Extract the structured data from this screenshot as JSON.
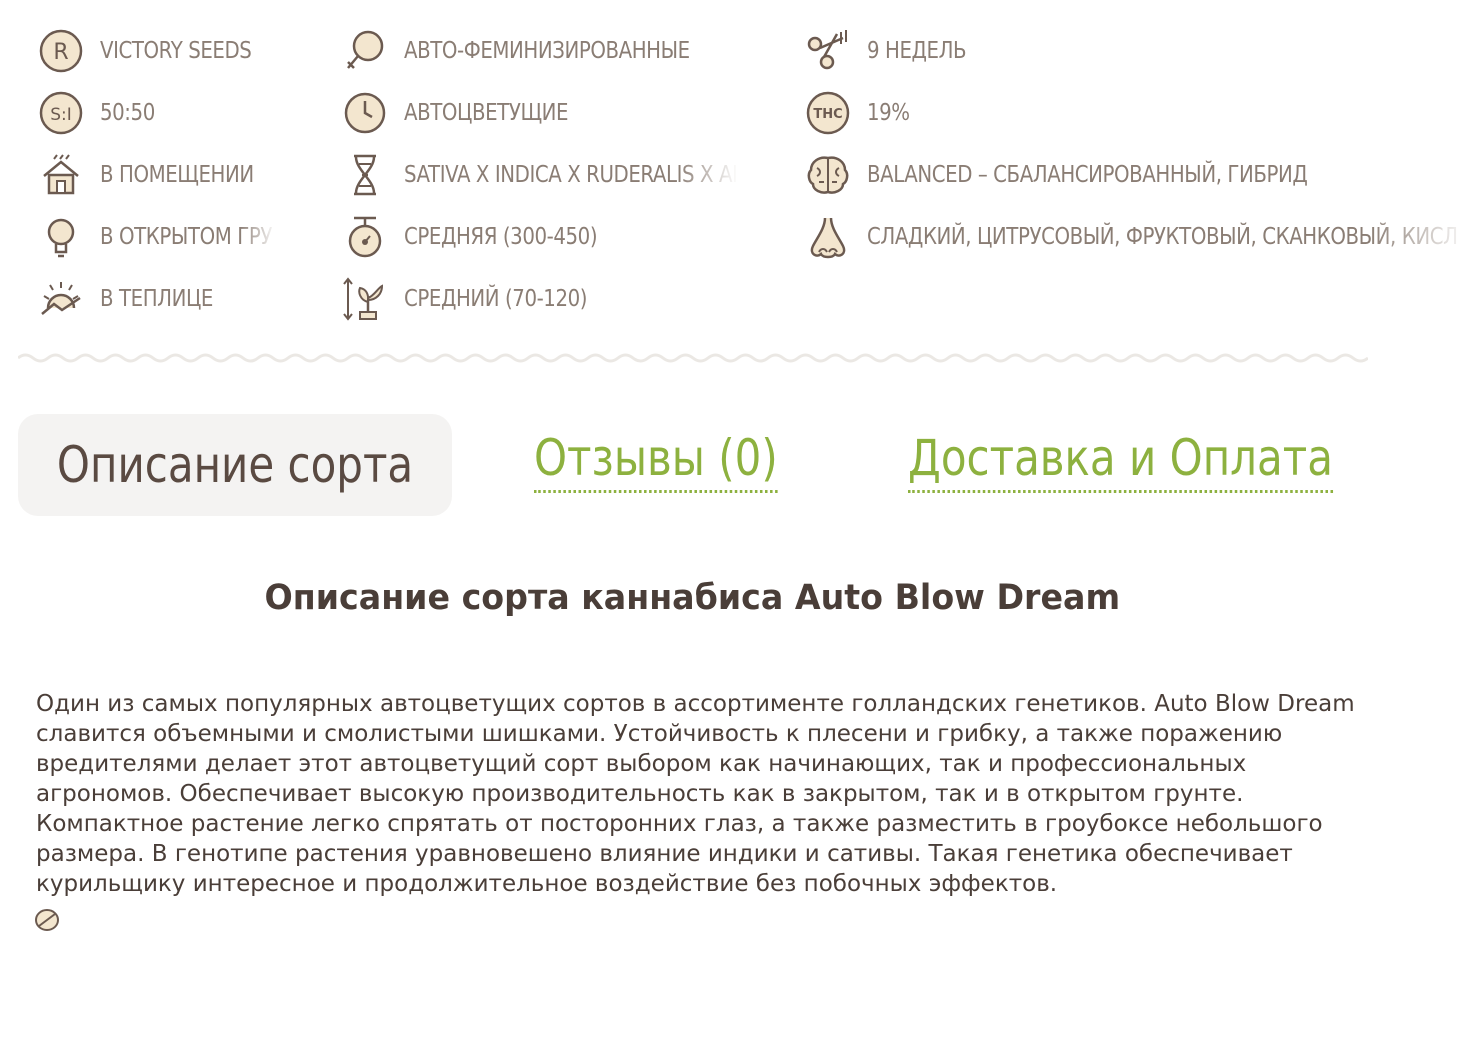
{
  "attributes": {
    "col1": [
      {
        "icon": "breeder-r-icon",
        "text": "VICTORY SEEDS"
      },
      {
        "icon": "sativa-indica-ratio-icon",
        "text": "50:50"
      },
      {
        "icon": "indoor-house-icon",
        "text": "В ПОМЕЩЕНИИ"
      },
      {
        "icon": "outdoor-lightbulb-icon",
        "text": "В ОТКРЫТОМ ГРУ"
      },
      {
        "icon": "greenhouse-sun-icon",
        "text": "В ТЕПЛИЦЕ"
      }
    ],
    "col2": [
      {
        "icon": "female-symbol-icon",
        "text": "АВТО-ФЕМИНИЗИРОВАННЫЕ"
      },
      {
        "icon": "clock-icon",
        "text": "АВТОЦВЕТУЩИЕ"
      },
      {
        "icon": "dna-icon",
        "text": "SATIVA X INDICA X RUDERALIS X AI"
      },
      {
        "icon": "weight-scale-icon",
        "text": "СРЕДНЯЯ (300-450)"
      },
      {
        "icon": "plant-height-icon",
        "text": "СРЕДНИЙ (70-120)"
      }
    ],
    "col3": [
      {
        "icon": "scissors-harvest-icon",
        "text": "9 НЕДЕЛЬ"
      },
      {
        "icon": "thc-badge-icon",
        "text": "19%"
      },
      {
        "icon": "brain-icon",
        "text": "BALANCED – СБАЛАНСИРОВАННЫЙ, ГИБРИД"
      },
      {
        "icon": "nose-icon",
        "text": "СЛАДКИЙ, ЦИТРУСОВЫЙ, ФРУКТОВЫЙ, СКАНКОВЫЙ, КИСЛ"
      }
    ]
  },
  "tabs": {
    "description": "Описание сорта",
    "reviews": "Отзывы (0)",
    "delivery": "Доставка и Оплата"
  },
  "content": {
    "heading": "Описание сорта каннабиса Auto Blow Dream",
    "body": "Один из самых популярных автоцветущих сортов в ассортименте голландских генетиков. Auto Blow Dream славится объемными и смолистыми шишками. Устойчивость к плесени и грибку, а также поражению вредителями делает этот автоцветущий сорт выбором как начинающих, так и профессиональных агрономов. Обеспечивает высокую производительность как в закрытом, так и в открытом грунте. Компактное растение легко спрятать от посторонних глаз, а также разместить в гроубоксе небольшого размера. В генотипе растения уравновешено влияние индики и сативы. Такая генетика обеспечивает курильщику интересное и продолжительное воздействие без побочных эффектов."
  },
  "colors": {
    "accent_green": "#8db13f",
    "text_brown": "#4a3e38",
    "attr_text": "#8a7d74",
    "icon_stroke": "#6b5a50",
    "icon_fill": "#f3e6cf"
  }
}
